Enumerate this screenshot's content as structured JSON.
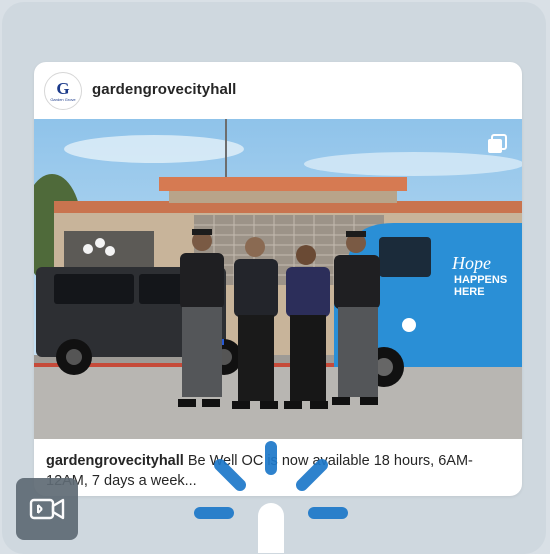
{
  "post": {
    "username": "gardengrovecityhall",
    "avatar_logo_letter": "G",
    "avatar_logo_text": "Garden Grove",
    "caption_user": "gardengrovecityhall",
    "caption_text": "Be Well OC is now available 18 hours, 6AM-12AM, 7 days a week...",
    "van_text_line1": "Hope",
    "van_text_line2": "HAPPENS",
    "van_text_line3": "HERE"
  },
  "icons": {
    "multi_image": "multiple-images-icon",
    "video": "video-camera-icon",
    "loading": "loading-spinner-icon"
  },
  "colors": {
    "accent_blue": "#1b7fd1",
    "van_blue": "#2a8fd6",
    "spinner_blue": "#1d78c9"
  }
}
